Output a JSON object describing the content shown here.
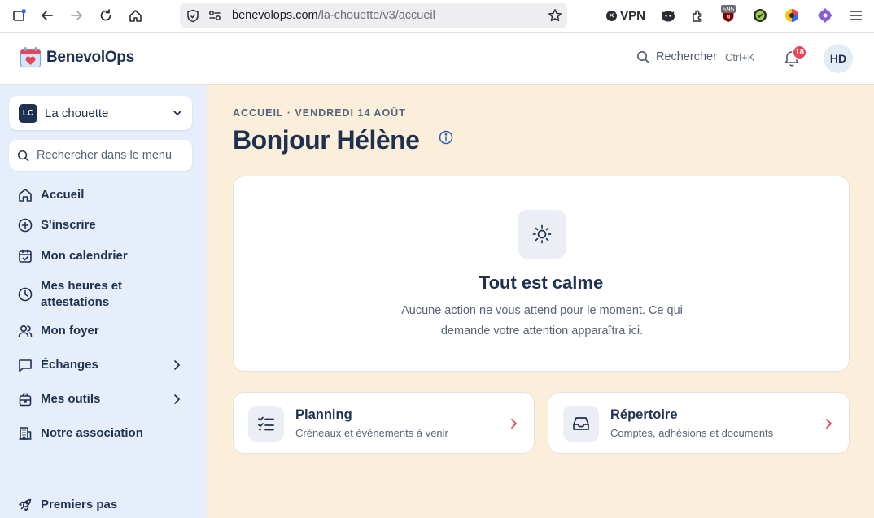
{
  "browser": {
    "url_host": "benevolops.com",
    "url_path": "/la-chouette/v3/accueil",
    "vpn_label": "VPN",
    "ublock_count": "595"
  },
  "header": {
    "logo_text": "BenevolOps",
    "search_label": "Rechercher",
    "search_shortcut": "Ctrl+K",
    "notification_count": "18",
    "avatar_initials": "HD"
  },
  "sidebar": {
    "org": {
      "badge": "LC",
      "name": "La chouette"
    },
    "search_placeholder": "Rechercher dans le menu",
    "items": [
      {
        "label": "Accueil",
        "icon": "home-icon"
      },
      {
        "label": "S'inscrire",
        "icon": "plus-circle-icon"
      },
      {
        "label": "Mon calendrier",
        "icon": "calendar-check-icon"
      },
      {
        "label": "Mes heures et attestations",
        "icon": "clock-icon"
      },
      {
        "label": "Mon foyer",
        "icon": "users-icon"
      },
      {
        "label": "Échanges",
        "icon": "message-square-icon"
      },
      {
        "label": "Mes outils",
        "icon": "briefcase-icon"
      },
      {
        "label": "Notre association",
        "icon": "building-icon"
      },
      {
        "label": "Premiers pas",
        "icon": "rocket-icon"
      }
    ]
  },
  "main": {
    "breadcrumb": "ACCUEIL · VENDREDI 14 AOÛT",
    "greeting": "Bonjour Hélène",
    "empty_state": {
      "title": "Tout est calme",
      "text": "Aucune action ne vous attend pour le moment. Ce qui demande votre attention apparaîtra ici."
    },
    "tiles": [
      {
        "title": "Planning",
        "subtitle": "Créneaux et événements à venir",
        "icon": "list-checks-icon"
      },
      {
        "title": "Répertoire",
        "subtitle": "Comptes, adhésions et documents",
        "icon": "inbox-icon"
      }
    ]
  },
  "colors": {
    "primary_text": "#1f3150",
    "sidebar_bg": "#e5eefa",
    "main_bg": "#fbefdc",
    "accent_red": "#e8455a",
    "icon_tile_bg": "#eceef6"
  }
}
